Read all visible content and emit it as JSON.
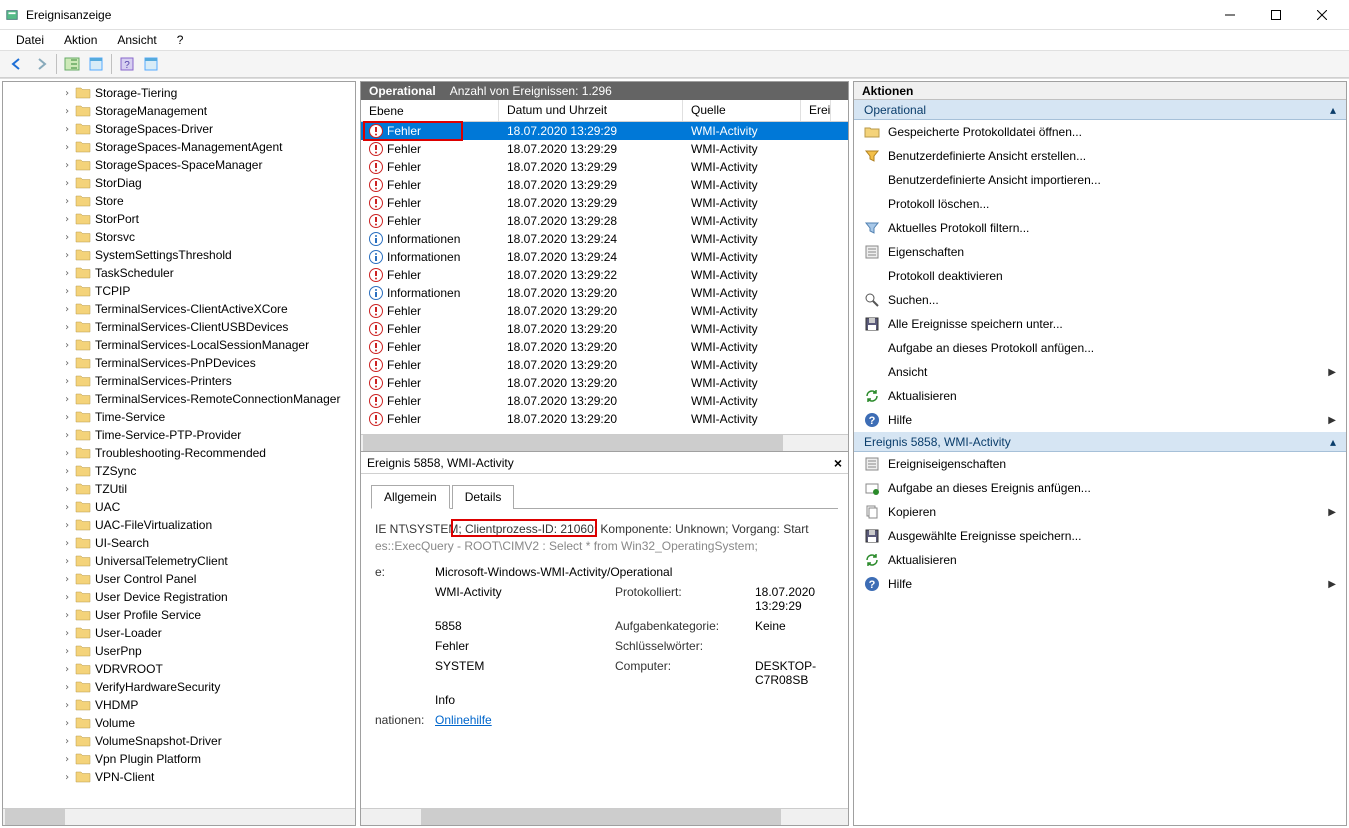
{
  "window": {
    "title": "Ereignisanzeige"
  },
  "menu": {
    "items": [
      "Datei",
      "Aktion",
      "Ansicht",
      "?"
    ]
  },
  "tree": {
    "items": [
      "Storage-Tiering",
      "StorageManagement",
      "StorageSpaces-Driver",
      "StorageSpaces-ManagementAgent",
      "StorageSpaces-SpaceManager",
      "StorDiag",
      "Store",
      "StorPort",
      "Storsvc",
      "SystemSettingsThreshold",
      "TaskScheduler",
      "TCPIP",
      "TerminalServices-ClientActiveXCore",
      "TerminalServices-ClientUSBDevices",
      "TerminalServices-LocalSessionManager",
      "TerminalServices-PnPDevices",
      "TerminalServices-Printers",
      "TerminalServices-RemoteConnectionManager",
      "Time-Service",
      "Time-Service-PTP-Provider",
      "Troubleshooting-Recommended",
      "TZSync",
      "TZUtil",
      "UAC",
      "UAC-FileVirtualization",
      "UI-Search",
      "UniversalTelemetryClient",
      "User Control Panel",
      "User Device Registration",
      "User Profile Service",
      "User-Loader",
      "UserPnp",
      "VDRVROOT",
      "VerifyHardwareSecurity",
      "VHDMP",
      "Volume",
      "VolumeSnapshot-Driver",
      "Vpn Plugin Platform",
      "VPN-Client"
    ]
  },
  "center": {
    "title": "Operational",
    "count_label": "Anzahl von Ereignissen: 1.296",
    "columns": {
      "level": "Ebene",
      "date": "Datum und Uhrzeit",
      "source": "Quelle",
      "eventid": "Erei"
    },
    "rows": [
      {
        "level": "Fehler",
        "type": "error",
        "date": "18.07.2020 13:29:29",
        "src": "WMI-Activity",
        "selected": true
      },
      {
        "level": "Fehler",
        "type": "error",
        "date": "18.07.2020 13:29:29",
        "src": "WMI-Activity"
      },
      {
        "level": "Fehler",
        "type": "error",
        "date": "18.07.2020 13:29:29",
        "src": "WMI-Activity"
      },
      {
        "level": "Fehler",
        "type": "error",
        "date": "18.07.2020 13:29:29",
        "src": "WMI-Activity"
      },
      {
        "level": "Fehler",
        "type": "error",
        "date": "18.07.2020 13:29:29",
        "src": "WMI-Activity"
      },
      {
        "level": "Fehler",
        "type": "error",
        "date": "18.07.2020 13:29:28",
        "src": "WMI-Activity"
      },
      {
        "level": "Informationen",
        "type": "info",
        "date": "18.07.2020 13:29:24",
        "src": "WMI-Activity"
      },
      {
        "level": "Informationen",
        "type": "info",
        "date": "18.07.2020 13:29:24",
        "src": "WMI-Activity"
      },
      {
        "level": "Fehler",
        "type": "error",
        "date": "18.07.2020 13:29:22",
        "src": "WMI-Activity"
      },
      {
        "level": "Informationen",
        "type": "info",
        "date": "18.07.2020 13:29:20",
        "src": "WMI-Activity"
      },
      {
        "level": "Fehler",
        "type": "error",
        "date": "18.07.2020 13:29:20",
        "src": "WMI-Activity"
      },
      {
        "level": "Fehler",
        "type": "error",
        "date": "18.07.2020 13:29:20",
        "src": "WMI-Activity"
      },
      {
        "level": "Fehler",
        "type": "error",
        "date": "18.07.2020 13:29:20",
        "src": "WMI-Activity"
      },
      {
        "level": "Fehler",
        "type": "error",
        "date": "18.07.2020 13:29:20",
        "src": "WMI-Activity"
      },
      {
        "level": "Fehler",
        "type": "error",
        "date": "18.07.2020 13:29:20",
        "src": "WMI-Activity"
      },
      {
        "level": "Fehler",
        "type": "error",
        "date": "18.07.2020 13:29:20",
        "src": "WMI-Activity"
      },
      {
        "level": "Fehler",
        "type": "error",
        "date": "18.07.2020 13:29:20",
        "src": "WMI-Activity"
      }
    ],
    "detail": {
      "header": "Ereignis 5858, WMI-Activity",
      "tabs": {
        "general": "Allgemein",
        "details": "Details"
      },
      "text_line1": "IE NT\\SYSTEM; Clientprozess-ID: 21060; Komponente: Unknown; Vorgang: Start",
      "text_line2": "es::ExecQuery - ROOT\\CIMV2 : Select * from Win32_OperatingSystem;",
      "rows": {
        "e_label": "e:",
        "e_val": "Microsoft-Windows-WMI-Activity/Operational",
        "src": "WMI-Activity",
        "p_label": "Protokolliert:",
        "p_val": "18.07.2020 13:29:29",
        "id": "5858",
        "cat_label": "Aufgabenkategorie:",
        "cat_val": "Keine",
        "lvl": "Fehler",
        "kw_label": "Schlüsselwörter:",
        "kw_val": "",
        "usr": "SYSTEM",
        "comp_label": "Computer:",
        "comp_val": "DESKTOP-C7R08SB",
        "op": "Info",
        "more_label": "nationen:",
        "link": "Onlinehilfe"
      }
    }
  },
  "actions": {
    "title": "Aktionen",
    "section1": "Operational",
    "section1_items": [
      {
        "icon": "open",
        "label": "Gespeicherte Protokolldatei öffnen..."
      },
      {
        "icon": "filter",
        "label": "Benutzerdefinierte Ansicht erstellen..."
      },
      {
        "icon": "",
        "label": "Benutzerdefinierte Ansicht importieren..."
      },
      {
        "icon": "",
        "label": "Protokoll löschen..."
      },
      {
        "icon": "filter2",
        "label": "Aktuelles Protokoll filtern..."
      },
      {
        "icon": "props",
        "label": "Eigenschaften"
      },
      {
        "icon": "",
        "label": "Protokoll deaktivieren"
      },
      {
        "icon": "search",
        "label": "Suchen..."
      },
      {
        "icon": "save",
        "label": "Alle Ereignisse speichern unter..."
      },
      {
        "icon": "",
        "label": "Aufgabe an dieses Protokoll anfügen..."
      },
      {
        "icon": "",
        "label": "Ansicht",
        "arrow": true
      },
      {
        "icon": "refresh",
        "label": "Aktualisieren"
      },
      {
        "icon": "help",
        "label": "Hilfe",
        "arrow": true
      }
    ],
    "section2": "Ereignis 5858, WMI-Activity",
    "section2_items": [
      {
        "icon": "props",
        "label": "Ereigniseigenschaften"
      },
      {
        "icon": "attach",
        "label": "Aufgabe an dieses Ereignis anfügen..."
      },
      {
        "icon": "copy",
        "label": "Kopieren",
        "arrow": true
      },
      {
        "icon": "save",
        "label": "Ausgewählte Ereignisse speichern..."
      },
      {
        "icon": "refresh",
        "label": "Aktualisieren"
      },
      {
        "icon": "help",
        "label": "Hilfe",
        "arrow": true
      }
    ]
  }
}
